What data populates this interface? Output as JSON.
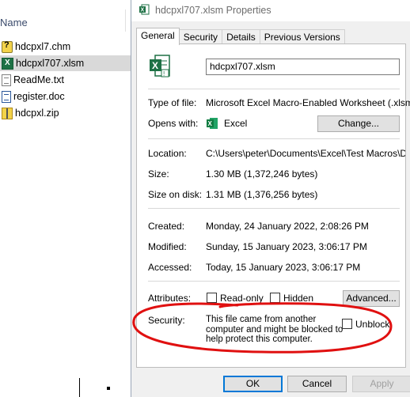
{
  "explorer": {
    "column_header": "Name",
    "files": [
      {
        "name": "hdcpxl7.chm",
        "icon": "chm-help-file-icon",
        "selected": false
      },
      {
        "name": "hdcpxl707.xlsm",
        "icon": "excel-macro-file-icon",
        "selected": true
      },
      {
        "name": "ReadMe.txt",
        "icon": "text-file-icon",
        "selected": false
      },
      {
        "name": "register.doc",
        "icon": "word-doc-file-icon",
        "selected": false
      },
      {
        "name": "hdcpxl.zip",
        "icon": "zip-folder-icon",
        "selected": false
      }
    ]
  },
  "dialog": {
    "title": "hdcpxl707.xlsm Properties",
    "tabs": [
      "General",
      "Security",
      "Details",
      "Previous Versions"
    ],
    "active_tab": "General",
    "filename": "hdcpxl707.xlsm",
    "type_label": "Type of file:",
    "type_value": "Microsoft Excel Macro-Enabled Worksheet (.xlsm)",
    "opens_label": "Opens with:",
    "opens_value": "Excel",
    "change_button": "Change...",
    "location_label": "Location:",
    "location_value": "C:\\Users\\peter\\Documents\\Excel\\Test Macros\\Dar",
    "size_label": "Size:",
    "size_value": "1.30 MB (1,372,246 bytes)",
    "size_on_disk_label": "Size on disk:",
    "size_on_disk_value": "1.31 MB (1,376,256 bytes)",
    "created_label": "Created:",
    "created_value": "Monday, 24 January 2022, 2:08:26 PM",
    "modified_label": "Modified:",
    "modified_value": "Sunday, 15 January 2023, 3:06:17 PM",
    "accessed_label": "Accessed:",
    "accessed_value": "Today, 15 January 2023, 3:06:17 PM",
    "attributes_label": "Attributes:",
    "readonly_label": "Read-only",
    "hidden_label": "Hidden",
    "advanced_button": "Advanced...",
    "security_label": "Security:",
    "security_lines": [
      "This file came from another",
      "computer and might be blocked to",
      "help protect this computer."
    ],
    "unblock_label": "Unblock",
    "ok_button": "OK",
    "cancel_button": "Cancel",
    "apply_button": "Apply"
  },
  "colors": {
    "excel_green": "#1e7145",
    "annotation_red": "#e01010",
    "selection": "#d9d9d9"
  }
}
